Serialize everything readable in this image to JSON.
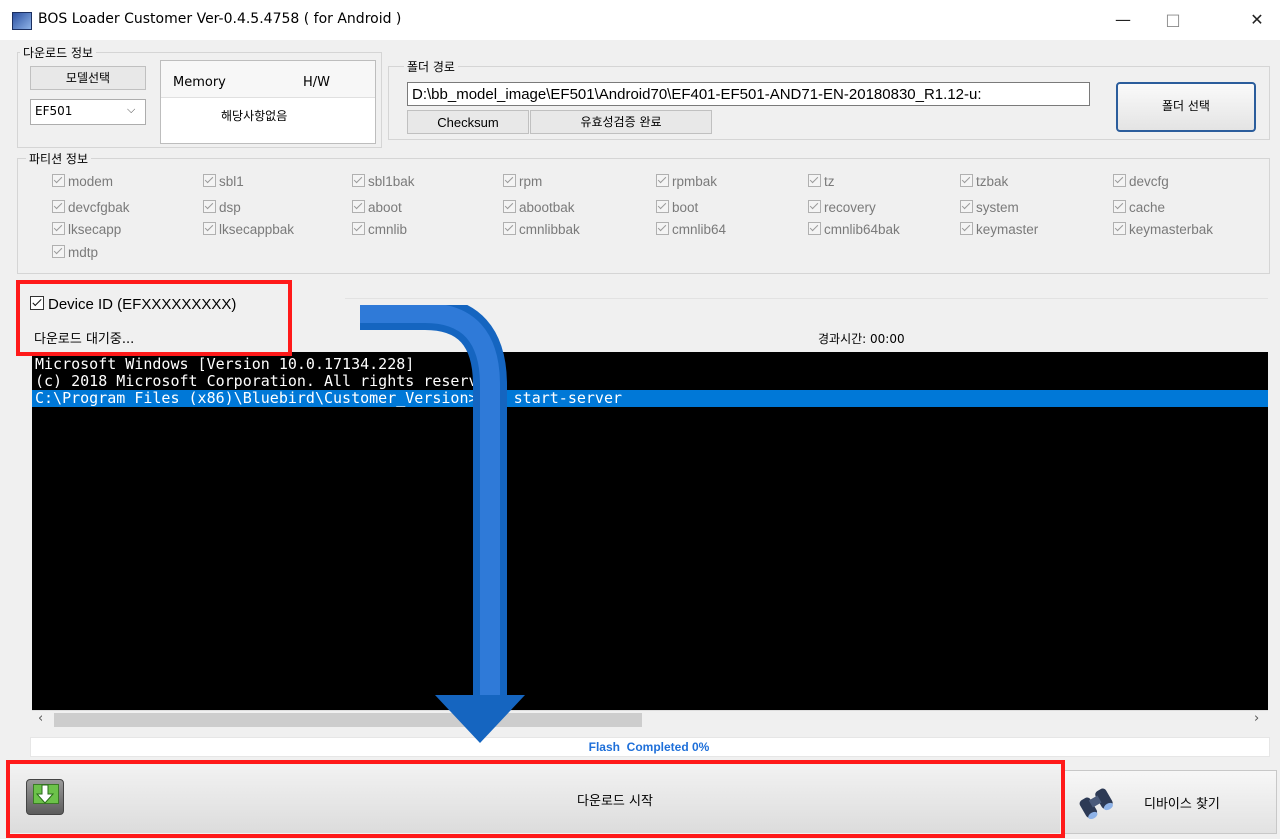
{
  "window": {
    "title": "BOS Loader Customer Ver-0.4.5.4758 ( for Android )",
    "minimize": "—",
    "maximize": "□",
    "close": "✕"
  },
  "download_info": {
    "group_label": "다운로드 정보",
    "model_select_label": "모델선택",
    "model_value": "EF501",
    "memory_label": "Memory",
    "hw_label": "H/W",
    "not_applicable": "해당사항없음"
  },
  "folder": {
    "group_label": "폴더 경로",
    "path": "D:\\bb_model_image\\EF501\\Android70\\EF401-EF501-AND71-EN-20180830_R1.12-u:",
    "checksum_label": "Checksum",
    "checksum_status": "유효성검증 완료",
    "select_button": "폴더 선택"
  },
  "partitions": {
    "group_label": "파티션 정보",
    "items": [
      "modem",
      "sbl1",
      "sbl1bak",
      "rpm",
      "rpmbak",
      "tz",
      "tzbak",
      "devcfg",
      "devcfgbak",
      "dsp",
      "aboot",
      "abootbak",
      "boot",
      "recovery",
      "system",
      "cache",
      "lksecapp",
      "lksecappbak",
      "cmnlib",
      "cmnlibbak",
      "cmnlib64",
      "cmnlib64bak",
      "keymaster",
      "keymasterbak",
      "mdtp"
    ]
  },
  "device": {
    "checkbox_label": "Device ID (EFXXXXXXXXX)",
    "status": "다운로드 대기중...",
    "elapsed_label": "경과시간: 00:00"
  },
  "console": {
    "lines": [
      "Microsoft Windows [Version 10.0.17134.228]",
      "(c) 2018 Microsoft Corporation. All rights reserved.",
      "C:\\Program Files (x86)\\Bluebird\\Customer_Version>adb start-server"
    ],
    "selected_line": 2
  },
  "progress": {
    "text": "Flash  Completed 0%",
    "percent": 0,
    "color": "#1e6fd9"
  },
  "actions": {
    "start_download": "다운로드 시작",
    "find_device": "디바이스 찾기"
  },
  "colors": {
    "highlight_red": "#ff1a1a",
    "arrow_blue": "#1565c0",
    "selection_blue": "#0078d7"
  },
  "icons": {
    "download": "download-icon",
    "binoculars": "binoculars-icon"
  }
}
